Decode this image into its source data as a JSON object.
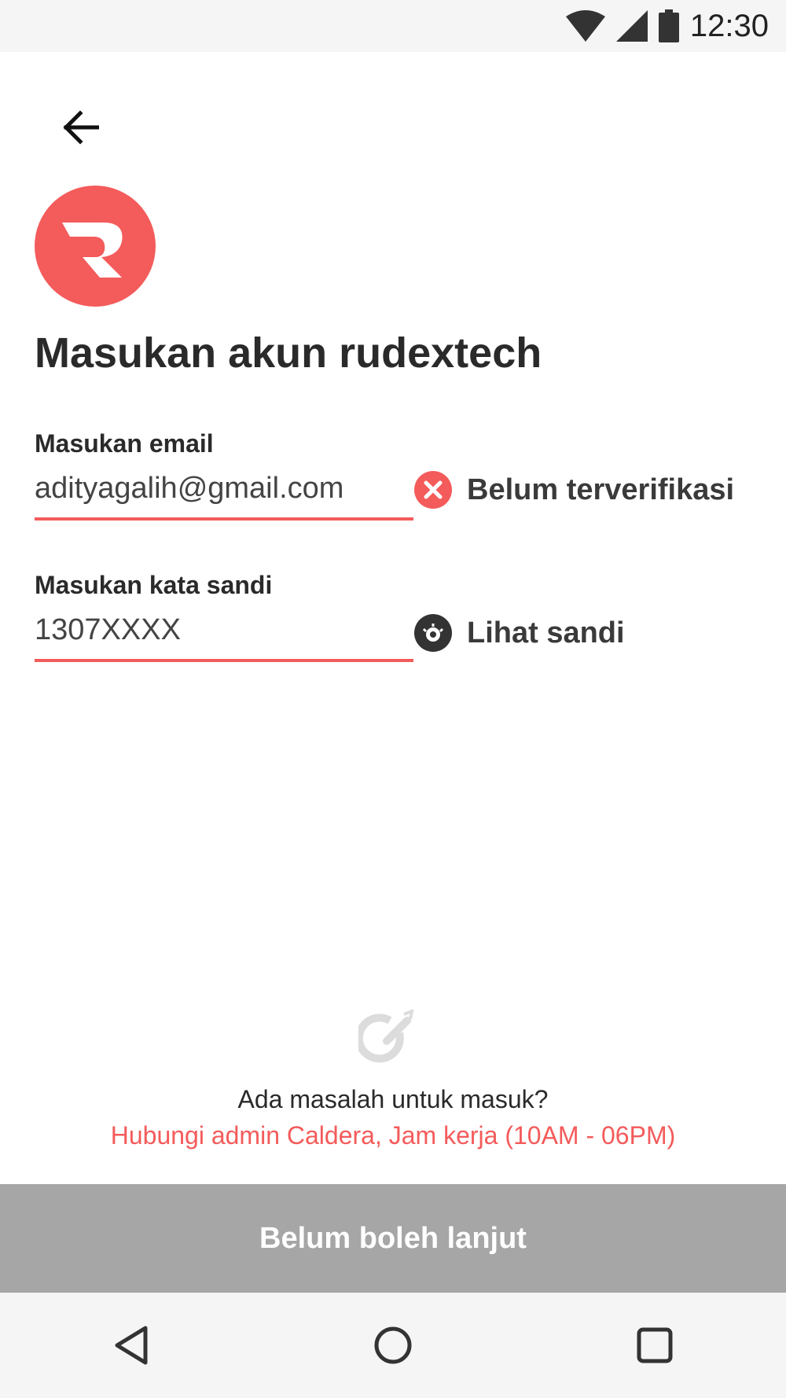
{
  "status_bar": {
    "time": "12:30",
    "icons": [
      "wifi-icon",
      "cell-signal-icon",
      "battery-icon"
    ]
  },
  "header": {
    "back_icon": "arrow-left-icon",
    "logo_icon": "rudextech-logo"
  },
  "title": "Masukan akun rudextech",
  "email": {
    "label": "Masukan email",
    "value": "adityagalih@gmail.com",
    "status_icon": "error-x-icon",
    "status_text": "Belum terverifikasi"
  },
  "password": {
    "label": "Masukan kata sandi",
    "value": "1307XXXX",
    "toggle_icon": "eye-icon",
    "toggle_text": "Lihat sandi"
  },
  "help": {
    "icon": "help-pointer-icon",
    "question": "Ada masalah untuk masuk?",
    "contact": "Hubungi admin Caldera, Jam kerja (10AM - 06PM)"
  },
  "continue_button": {
    "label": "Belum boleh lanjut"
  },
  "nav": {
    "back": "nav-back-icon",
    "home": "nav-home-icon",
    "recents": "nav-recents-icon"
  },
  "colors": {
    "accent": "#f45b5b",
    "disabled_button": "#a6a6a6",
    "text_dark": "#2a2a2a"
  }
}
